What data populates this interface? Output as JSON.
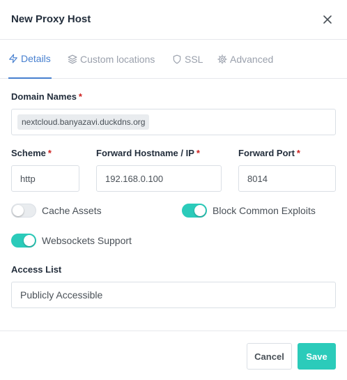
{
  "modal": {
    "title": "New Proxy Host"
  },
  "tabs": [
    {
      "label": "Details",
      "icon": "lightning-icon",
      "active": true
    },
    {
      "label": "Custom locations",
      "icon": "layers-icon",
      "active": false
    },
    {
      "label": "SSL",
      "icon": "shield-icon",
      "active": false
    },
    {
      "label": "Advanced",
      "icon": "gear-icon",
      "active": false
    }
  ],
  "form": {
    "domain_names": {
      "label": "Domain Names",
      "required_mark": "*",
      "tags": [
        "nextcloud.banyazavi.duckdns.org"
      ]
    },
    "scheme": {
      "label": "Scheme",
      "required_mark": "*",
      "value": "http"
    },
    "forward_hostname": {
      "label": "Forward Hostname / IP",
      "required_mark": "*",
      "value": "192.168.0.100"
    },
    "forward_port": {
      "label": "Forward Port",
      "required_mark": "*",
      "value": "8014"
    },
    "toggles": {
      "cache_assets": {
        "label": "Cache Assets",
        "on": false
      },
      "block_common_exploits": {
        "label": "Block Common Exploits",
        "on": true
      },
      "websockets_support": {
        "label": "Websockets Support",
        "on": true
      }
    },
    "access_list": {
      "label": "Access List",
      "value": "Publicly Accessible"
    }
  },
  "footer": {
    "cancel_label": "Cancel",
    "save_label": "Save"
  },
  "colors": {
    "accent_blue": "#467fcf",
    "teal": "#2bcbba",
    "required_red": "#cd201f"
  }
}
